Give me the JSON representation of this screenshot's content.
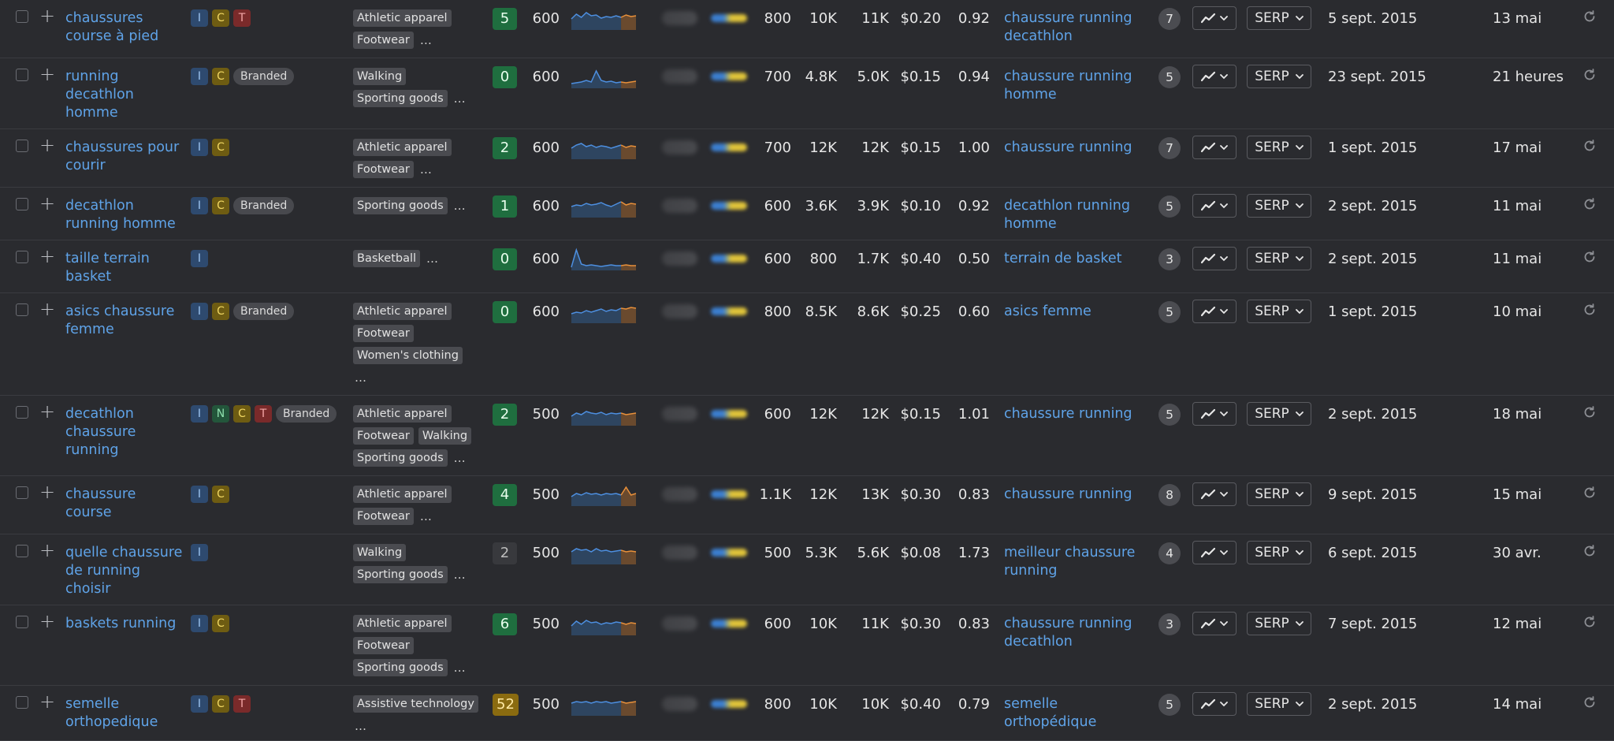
{
  "table": {
    "serp_label": "SERP",
    "rows": [
      {
        "keyword": "chaussures course à pied",
        "intents": [
          "I",
          "C",
          "T"
        ],
        "categories": [
          "Athletic apparel",
          "Footwear"
        ],
        "more": "…",
        "kd": "5",
        "kd_color": "green",
        "volume": "600",
        "gv": "800",
        "tp": "10K",
        "tv": "11K",
        "cpc": "$0.20",
        "com": "0.92",
        "parent": "chaussure running decathlon",
        "serp_count": "7",
        "first_seen": "5 sept. 2015",
        "updated": "13 mai",
        "height": 74,
        "trend": [
          14,
          8,
          12,
          6,
          10,
          9,
          13,
          11,
          12,
          10,
          12,
          9,
          11,
          10
        ]
      },
      {
        "keyword": "running decathlon homme",
        "intents": [
          "I",
          "C",
          "Branded"
        ],
        "categories": [
          "Walking",
          "Sporting goods"
        ],
        "more": "…",
        "kd": "0",
        "kd_color": "green",
        "volume": "600",
        "gv": "700",
        "tp": "4.8K",
        "tv": "5.0K",
        "cpc": "$0.15",
        "com": "0.94",
        "parent": "chaussure running homme",
        "serp_count": "5",
        "first_seen": "23 sept. 2015",
        "updated": "21 heures",
        "height": 90,
        "trend": [
          22,
          21,
          20,
          18,
          20,
          6,
          18,
          20,
          19,
          21,
          20,
          21,
          20,
          19
        ]
      },
      {
        "keyword": "chaussures pour courir",
        "intents": [
          "I",
          "C"
        ],
        "categories": [
          "Athletic apparel",
          "Footwear"
        ],
        "more": "…",
        "kd": "2",
        "kd_color": "green",
        "volume": "600",
        "gv": "700",
        "tp": "12K",
        "tv": "12K",
        "cpc": "$0.15",
        "com": "1.00",
        "parent": "chaussure running",
        "serp_count": "7",
        "first_seen": "1 sept. 2015",
        "updated": "17 mai",
        "height": 74,
        "trend": [
          14,
          10,
          8,
          12,
          10,
          13,
          11,
          12,
          14,
          12,
          10,
          13,
          11,
          12
        ]
      },
      {
        "keyword": "decathlon running homme",
        "intents": [
          "I",
          "C",
          "Branded"
        ],
        "categories": [
          "Sporting goods"
        ],
        "more": "…",
        "kd": "1",
        "kd_color": "green",
        "volume": "600",
        "gv": "600",
        "tp": "3.6K",
        "tv": "3.9K",
        "cpc": "$0.10",
        "com": "0.92",
        "parent": "decathlon running homme",
        "serp_count": "5",
        "first_seen": "2 sept. 2015",
        "updated": "11 mai",
        "height": 67,
        "trend": [
          14,
          12,
          13,
          10,
          12,
          11,
          9,
          12,
          14,
          11,
          8,
          12,
          10,
          11
        ]
      },
      {
        "keyword": "taille terrain basket",
        "intents": [
          "I"
        ],
        "categories": [
          "Basketball"
        ],
        "more": "…",
        "kd": "0",
        "kd_color": "green",
        "volume": "600",
        "gv": "600",
        "tp": "800",
        "tv": "1.7K",
        "cpc": "$0.40",
        "com": "0.50",
        "parent": "terrain de basket",
        "serp_count": "3",
        "first_seen": "2 sept. 2015",
        "updated": "11 mai",
        "height": 67,
        "trend": [
          24,
          2,
          20,
          22,
          21,
          22,
          23,
          22,
          21,
          22,
          22,
          21,
          22,
          22
        ]
      },
      {
        "keyword": "asics chaussure femme",
        "intents": [
          "I",
          "C",
          "Branded"
        ],
        "categories": [
          "Athletic apparel",
          "Footwear",
          "Women's clothing"
        ],
        "more": "…",
        "kd": "0",
        "kd_color": "green",
        "volume": "600",
        "gv": "800",
        "tp": "8.5K",
        "tv": "8.6K",
        "cpc": "$0.25",
        "com": "0.60",
        "parent": "asics femme",
        "serp_count": "5",
        "first_seen": "1 sept. 2015",
        "updated": "10 mai",
        "height": 130,
        "trend": [
          16,
          14,
          15,
          12,
          14,
          12,
          10,
          13,
          11,
          12,
          9,
          10,
          8,
          9
        ]
      },
      {
        "keyword": "decathlon chaussure running",
        "intents": [
          "I",
          "N",
          "C",
          "T",
          "Branded"
        ],
        "categories": [
          "Athletic apparel",
          "Footwear",
          "Walking",
          "Sporting goods"
        ],
        "more": "…",
        "kd": "2",
        "kd_color": "green",
        "volume": "500",
        "gv": "600",
        "tp": "12K",
        "tv": "12K",
        "cpc": "$0.15",
        "com": "1.01",
        "parent": "chaussure running",
        "serp_count": "5",
        "first_seen": "2 sept. 2015",
        "updated": "18 mai",
        "height": 102,
        "trend": [
          16,
          12,
          14,
          10,
          12,
          13,
          11,
          14,
          12,
          13,
          12,
          14,
          13,
          12
        ]
      },
      {
        "keyword": "chaussure course",
        "intents": [
          "I",
          "C"
        ],
        "categories": [
          "Athletic apparel",
          "Footwear"
        ],
        "more": "…",
        "kd": "4",
        "kd_color": "green",
        "volume": "500",
        "gv": "1.1K",
        "tp": "12K",
        "tv": "13K",
        "cpc": "$0.30",
        "com": "0.83",
        "parent": "chaussure running",
        "serp_count": "8",
        "first_seen": "9 sept. 2015",
        "updated": "15 mai",
        "height": 74,
        "trend": [
          16,
          12,
          14,
          11,
          13,
          12,
          14,
          12,
          13,
          12,
          14,
          4,
          14,
          12
        ]
      },
      {
        "keyword": "quelle chaussure de running choisir",
        "intents": [
          "I"
        ],
        "categories": [
          "Walking",
          "Sporting goods"
        ],
        "more": "…",
        "kd": "2",
        "kd_color": "gray",
        "volume": "500",
        "gv": "500",
        "tp": "5.3K",
        "tv": "5.6K",
        "cpc": "$0.08",
        "com": "1.73",
        "parent": "meilleur chaussure running",
        "serp_count": "4",
        "first_seen": "6 sept. 2015",
        "updated": "30 avr.",
        "height": 90,
        "trend": [
          12,
          8,
          10,
          9,
          12,
          8,
          11,
          10,
          12,
          11,
          10,
          12,
          11,
          12
        ]
      },
      {
        "keyword": "baskets running",
        "intents": [
          "I",
          "C"
        ],
        "categories": [
          "Athletic apparel",
          "Footwear",
          "Sporting goods"
        ],
        "more": "…",
        "kd": "6",
        "kd_color": "green",
        "volume": "500",
        "gv": "600",
        "tp": "10K",
        "tv": "11K",
        "cpc": "$0.30",
        "com": "0.83",
        "parent": "chaussure running decathlon",
        "serp_count": "3",
        "first_seen": "7 sept. 2015",
        "updated": "12 mai",
        "height": 102,
        "trend": [
          16,
          10,
          14,
          9,
          12,
          11,
          14,
          12,
          13,
          11,
          12,
          14,
          12,
          13
        ]
      },
      {
        "keyword": "semelle orthopedique",
        "intents": [
          "I",
          "C",
          "T"
        ],
        "categories": [
          "Assistive technology"
        ],
        "more": "…",
        "kd": "52",
        "kd_color": "yellow",
        "volume": "500",
        "gv": "800",
        "tp": "10K",
        "tv": "10K",
        "cpc": "$0.40",
        "com": "0.79",
        "parent": "semelle orthopédique",
        "serp_count": "5",
        "first_seen": "2 sept. 2015",
        "updated": "14 mai",
        "height": 70,
        "trend": [
          12,
          10,
          11,
          10,
          12,
          10,
          11,
          10,
          12,
          11,
          10,
          12,
          11,
          10
        ]
      }
    ]
  }
}
